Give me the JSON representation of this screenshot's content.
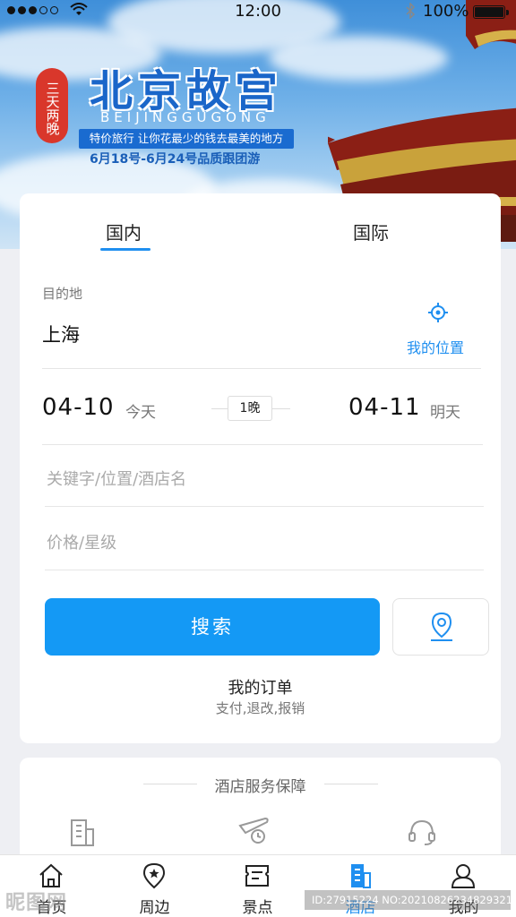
{
  "status_bar": {
    "time": "12:00",
    "battery": "100%",
    "icons": [
      "signal-dots-icon",
      "wifi-icon",
      "bluetooth-icon",
      "battery-icon"
    ]
  },
  "banner": {
    "seal": "三天两晚",
    "title": "北京故宫",
    "subtitle": "BEIJINGGUGONG",
    "ribbon": "特价旅行 让你花最少的钱去最美的地方",
    "dates": "6月18号-6月24号品质跟团游"
  },
  "tabs": {
    "domestic": "国内",
    "international": "国际",
    "active": "domestic"
  },
  "destination": {
    "label": "目的地",
    "value": "上海",
    "my_location": "我的位置"
  },
  "dates": {
    "check_in": "04-10",
    "check_in_label": "今天",
    "nights": "1晚",
    "check_out": "04-11",
    "check_out_label": "明天"
  },
  "fields": {
    "keyword_placeholder": "关键字/位置/酒店名",
    "price_placeholder": "价格/星级"
  },
  "search_button": "搜索",
  "orders": {
    "title": "我的订单",
    "subtitle": "支付,退改,报销"
  },
  "service": {
    "title": "酒店服务保障",
    "icons": [
      "building-icon",
      "plane-clock-icon",
      "headset-icon"
    ]
  },
  "tabbar": {
    "items": [
      {
        "label": "首页",
        "icon": "home-icon"
      },
      {
        "label": "周边",
        "icon": "location-star-icon"
      },
      {
        "label": "景点",
        "icon": "ticket-icon"
      },
      {
        "label": "酒店",
        "icon": "hotel-icon"
      },
      {
        "label": "我的",
        "icon": "user-icon"
      }
    ],
    "active_index": 3
  },
  "watermark": {
    "left": "昵图网",
    "right": "ID:27915224 NO:20210826234829321"
  },
  "colors": {
    "accent": "#1f8ff0",
    "button": "#1499f5",
    "seal": "#d9372b"
  }
}
